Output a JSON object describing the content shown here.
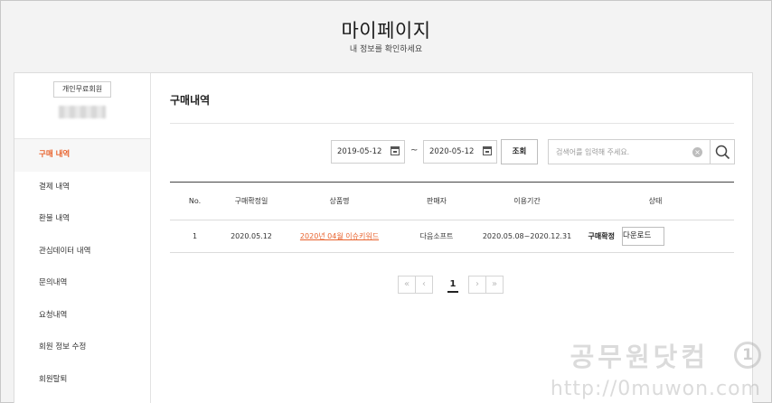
{
  "header": {
    "title": "마이페이지",
    "subtitle": "내 정보를 확인하세요"
  },
  "sidebar": {
    "member_badge": "개인무료회원",
    "items": [
      {
        "label": "구매 내역",
        "active": true
      },
      {
        "label": "결제 내역"
      },
      {
        "label": "환불 내역"
      },
      {
        "label": "관심데이터 내역"
      },
      {
        "label": "문의내역"
      },
      {
        "label": "요청내역"
      },
      {
        "label": "회원 정보 수정"
      },
      {
        "label": "회원탈퇴"
      }
    ]
  },
  "main": {
    "section_title": "구매내역",
    "filters": {
      "start_date": "2019-05-12",
      "separator": "~",
      "end_date": "2020-05-12",
      "search_button": "조회",
      "search_placeholder": "검색어를 입력해 주세요."
    },
    "table": {
      "headers": [
        "No.",
        "구매확정일",
        "상품명",
        "판매자",
        "이용기간",
        "상태"
      ],
      "rows": [
        {
          "no": "1",
          "confirm_date": "2020.05.12",
          "product": "2020년 04월 이슈키워드",
          "seller": "다음소프트",
          "period": "2020.05.08~2020.12.31",
          "status": "구매확정",
          "action": "다운로드"
        }
      ]
    },
    "pagination": {
      "first": "«",
      "prev": "‹",
      "current": "1",
      "next": "›",
      "last": "»"
    }
  },
  "watermark": {
    "line1": "공무원닷컴",
    "logo": "1",
    "line2": "http://0muwon.com"
  },
  "colors": {
    "accent": "#e8622c",
    "background": "#f3f3f3"
  }
}
